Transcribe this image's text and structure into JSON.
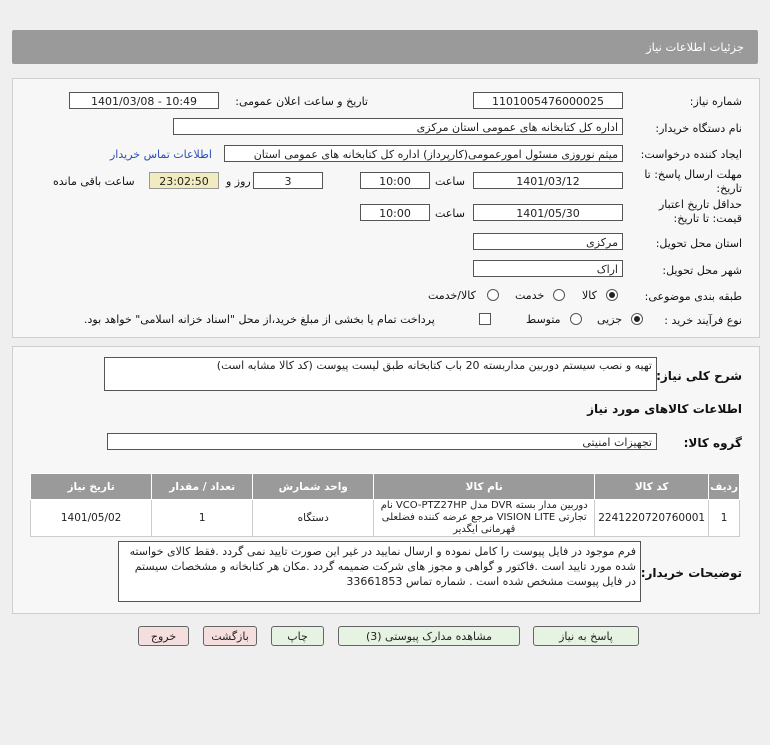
{
  "header": {
    "title": "جزئیات اطلاعات نیاز"
  },
  "form": {
    "need_number_label": "شماره نیاز:",
    "need_number": "1101005476000025",
    "announce_label": "تاریخ و ساعت اعلان عمومی:",
    "announce_value": "1401/03/08 - 10:49",
    "buyer_org_label": "نام دستگاه خریدار:",
    "buyer_org": "اداره کل کتابخانه های عمومی استان مرکزی",
    "creator_label": "ایجاد کننده درخواست:",
    "creator": "میثم نوروزی مسئول امورعمومی(کارپرداز) اداره کل کتابخانه های عمومی استان",
    "contact_link": "اطلاعات تماس خریدار",
    "reply_deadline_label": "مهلت ارسال پاسخ: تا تاریخ:",
    "reply_date": "1401/03/12",
    "time_word": "ساعت",
    "reply_time": "10:00",
    "days_value": "3",
    "days_and": "روز و",
    "remaining_time": "23:02:50",
    "remaining_label": "ساعت باقی مانده",
    "price_validity_label": "حداقل تاریخ اعتبار قیمت: تا تاریخ:",
    "validity_date": "1401/05/30",
    "validity_time": "10:00",
    "delivery_province_label": "استان محل تحویل:",
    "delivery_province": "مرکزی",
    "delivery_city_label": "شهر محل تحویل:",
    "delivery_city": "اراک",
    "category_label": "طبقه بندی موضوعی:",
    "category_options": [
      "کالا",
      "خدمت",
      "کالا/خدمت"
    ],
    "process_label": "نوع فرآیند خرید :",
    "process_options": [
      "جزیی",
      "متوسط"
    ],
    "payment_note": "پرداخت تمام یا بخشی از مبلغ خرید،از محل \"اسناد خزانه اسلامی\" خواهد بود."
  },
  "details": {
    "summary_label": "شرح کلی نیاز:",
    "summary": "تهیه و نصب سیستم دوربین مداربسته 20 باب کتابخانه طبق لیست پیوست (کد کالا مشابه است)",
    "goods_info_title": "اطلاعات کالاهای مورد نیاز",
    "goods_group_label": "گروه کالا:",
    "goods_group": "تجهیزات امنیتی",
    "table": {
      "headers": [
        "ردیف",
        "کد کالا",
        "نام کالا",
        "واحد شمارش",
        "تعداد / مقدار",
        "تاریخ نیاز"
      ],
      "rows": [
        [
          "1",
          "2241220720760001",
          "دوربین مدار بسته DVR مدل VCO-PTZ27HP نام تجارتی VISION LITE مرجع عرضه کننده فضلعلی قهرمانی ایگدیر",
          "دستگاه",
          "1",
          "1401/05/02"
        ]
      ]
    },
    "buyer_notes_label": "توضیحات خریدار:",
    "buyer_notes": "فرم موجود در فایل پیوست را کامل نموده و ارسال نمایید در غیر این صورت تایید نمی گردد .فقط کالای خواسته شده مورد تایید است .فاکتور و گواهی و مجوز های شرکت  ضمیمه گردد .مکان هر کتابخانه و مشخصات سیستم در فایل پیوست مشخص شده است . شماره تماس 33661853"
  },
  "buttons": {
    "reply": "پاسخ به نیاز",
    "attachments": "مشاهده مدارک پیوستی (3)",
    "print": "چاپ",
    "back": "بازگشت",
    "exit": "خروج"
  },
  "watermark": {
    "brand": "ParsNamadData",
    "line1": "مرکز فراوری اطلاعات پارس نماد داده",
    "line2": "پایگاه اطلاع رسانی مناقصات و مزایدات"
  },
  "colors": {
    "header_bg": "#9a9a9a",
    "link": "#2a4fb5",
    "button_green": "#e6f3e2",
    "button_red": "#f5dede"
  }
}
